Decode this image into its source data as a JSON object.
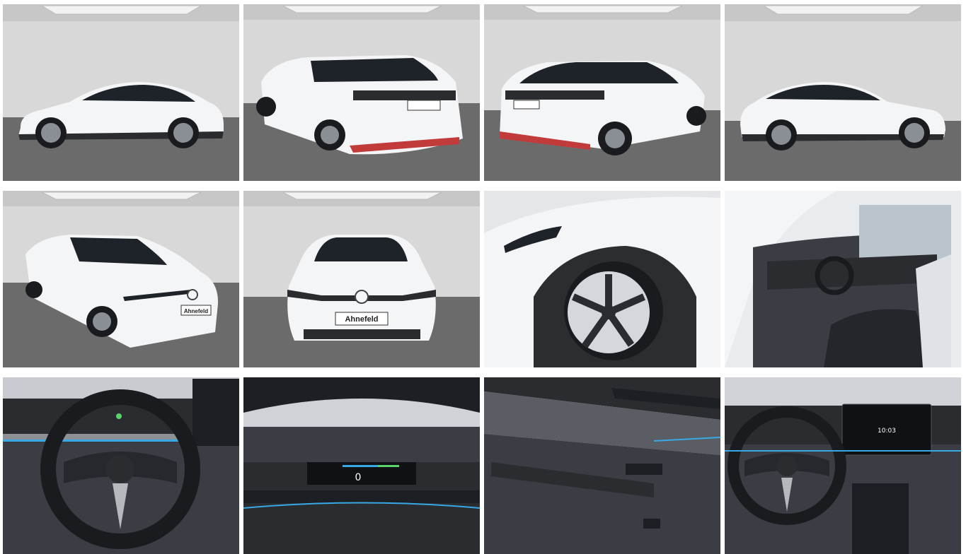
{
  "gallery": {
    "photos": [
      {
        "view": "side-left",
        "label": ""
      },
      {
        "view": "rear-left",
        "label": ""
      },
      {
        "view": "rear-right",
        "label": ""
      },
      {
        "view": "side-right",
        "label": ""
      },
      {
        "view": "front-left",
        "label": ""
      },
      {
        "view": "front",
        "label": ""
      },
      {
        "view": "wheel-detail",
        "label": ""
      },
      {
        "view": "interior-driver-seat",
        "label": ""
      },
      {
        "view": "steering-wheel",
        "label": ""
      },
      {
        "view": "instrument-cluster",
        "label": ""
      },
      {
        "view": "door-panel",
        "label": ""
      },
      {
        "view": "dashboard",
        "label": ""
      }
    ],
    "plate_text": "Ahnefeld",
    "speed_readout": "0",
    "clock_readout": "10:03",
    "colors": {
      "studio_wall": "#d9d9d9",
      "studio_floor": "#6a6a6a",
      "car_white": "#f4f5f7",
      "glass": "#1e2229",
      "ambient_blue": "#39a9e6"
    }
  }
}
